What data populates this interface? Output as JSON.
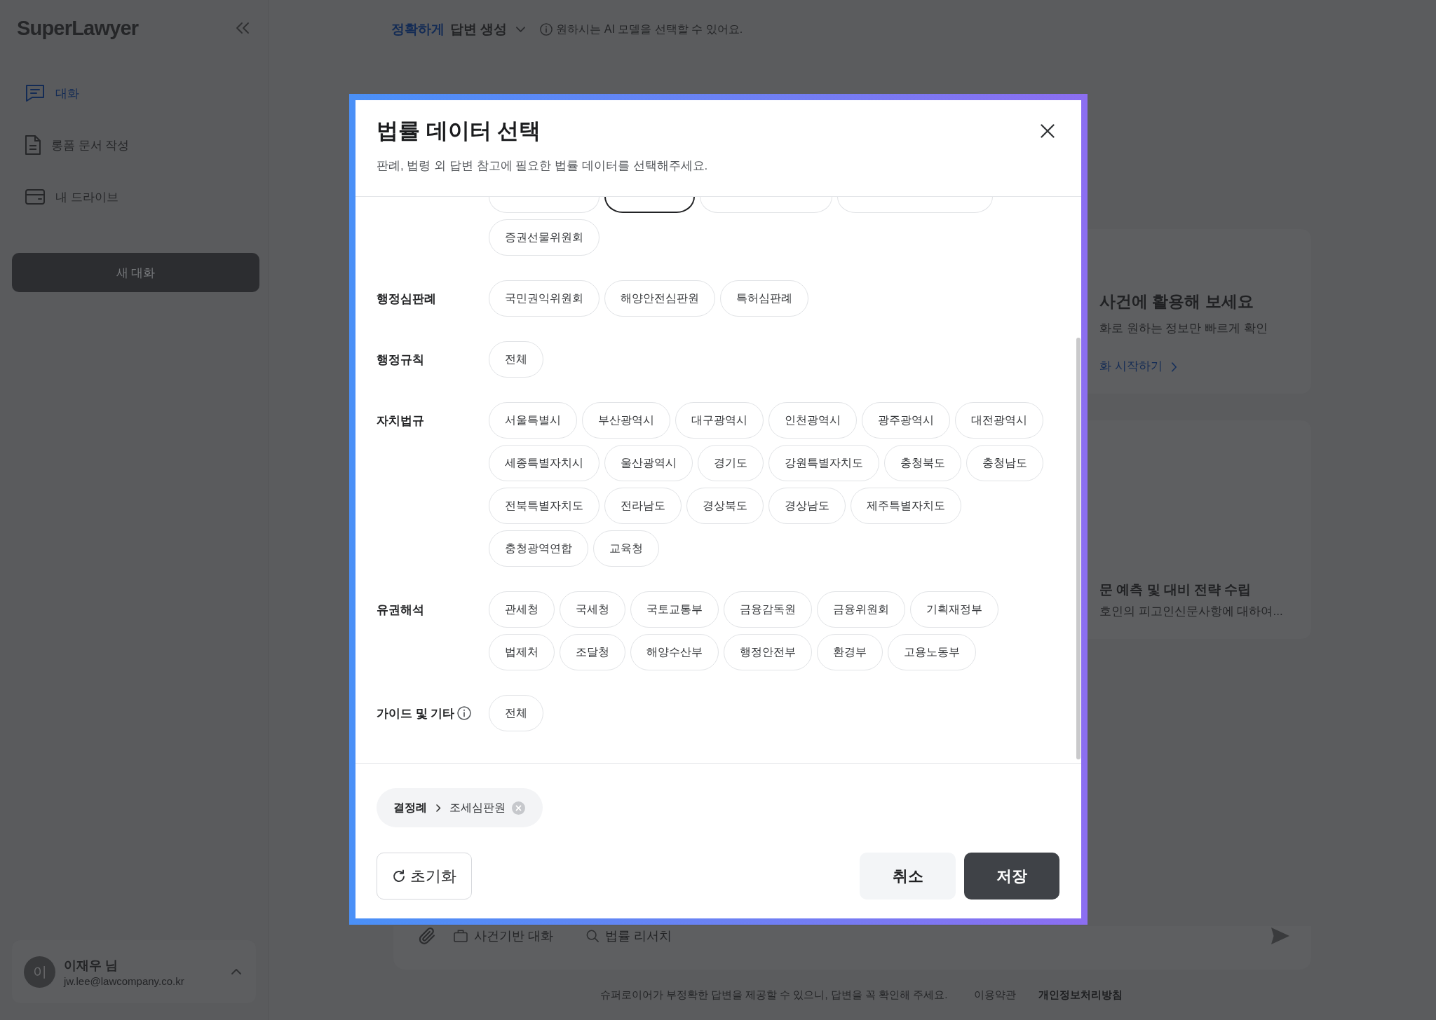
{
  "sidebar": {
    "logo": "SuperLawyer",
    "nav": [
      {
        "label": "대화",
        "kind": "chat",
        "selected": true
      },
      {
        "label": "롱폼 문서 작성",
        "kind": "document",
        "selected": false
      },
      {
        "label": "내 드라이브",
        "kind": "drive",
        "selected": false
      }
    ],
    "new_chat_button": "새 대화",
    "user": {
      "avatar": "이",
      "name": "이재우 님",
      "email": "jw.lee@lawcompany.co.kr"
    }
  },
  "header": {
    "mode": "정확하게",
    "label": "답변 생성",
    "hint": "원하시는 AI 모델을 선택할 수 있어요."
  },
  "cards": [
    {
      "kind": "banner",
      "title": "사건에 활용해 보세요",
      "text": "화로 원하는 정보만 빠르게 확인",
      "link": "화 시작하기"
    },
    {
      "kind": "recent",
      "title": "문 예측 및 대비 전략 수립",
      "text": "호인의 피고인신문사항에 대하여..."
    }
  ],
  "composer": {
    "tools": [
      {
        "kind": "case",
        "label": "사건기반 대화"
      },
      {
        "kind": "research",
        "label": "법률 리서치"
      }
    ]
  },
  "footer": {
    "notice": "슈퍼로이어가 부정확한 답변을 제공할 수 있으니, 답변을 꼭 확인해 주세요.",
    "links": [
      {
        "label": "이용약관",
        "emphasized": false
      },
      {
        "label": "개인정보처리방침",
        "emphasized": true
      }
    ]
  },
  "modal": {
    "title": "법률 데이터 선택",
    "subtitle": "판례, 법령 외 답변 참고에 필요한 법률 데이터를 선택해주세요.",
    "sections": [
      {
        "clipped_chips": [
          {
            "selected": false
          },
          {
            "selected": true
          },
          {
            "selected": false
          },
          {
            "selected": false
          }
        ],
        "chips": [
          {
            "label": "증권선물위원회",
            "selected": false
          }
        ]
      },
      {
        "label": "행정심판례",
        "info": false,
        "chips": [
          {
            "label": "국민권익위원회",
            "selected": false
          },
          {
            "label": "해양안전심판원",
            "selected": false
          },
          {
            "label": "특허심판례",
            "selected": false
          }
        ]
      },
      {
        "label": "행정규칙",
        "info": false,
        "chips": [
          {
            "label": "전체",
            "selected": false
          }
        ]
      },
      {
        "label": "자치법규",
        "info": false,
        "chips": [
          {
            "label": "서울특별시",
            "selected": false
          },
          {
            "label": "부산광역시",
            "selected": false
          },
          {
            "label": "대구광역시",
            "selected": false
          },
          {
            "label": "인천광역시",
            "selected": false
          },
          {
            "label": "광주광역시",
            "selected": false
          },
          {
            "label": "대전광역시",
            "selected": false
          },
          {
            "label": "세종특별자치시",
            "selected": false
          },
          {
            "label": "울산광역시",
            "selected": false
          },
          {
            "label": "경기도",
            "selected": false
          },
          {
            "label": "강원특별자치도",
            "selected": false
          },
          {
            "label": "충청북도",
            "selected": false
          },
          {
            "label": "충청남도",
            "selected": false
          },
          {
            "label": "전북특별자치도",
            "selected": false
          },
          {
            "label": "전라남도",
            "selected": false
          },
          {
            "label": "경상북도",
            "selected": false
          },
          {
            "label": "경상남도",
            "selected": false
          },
          {
            "label": "제주특별자치도",
            "selected": false
          },
          {
            "label": "충청광역연합",
            "selected": false
          },
          {
            "label": "교육청",
            "selected": false
          }
        ]
      },
      {
        "label": "유권해석",
        "info": false,
        "chips": [
          {
            "label": "관세청",
            "selected": false
          },
          {
            "label": "국세청",
            "selected": false
          },
          {
            "label": "국토교통부",
            "selected": false
          },
          {
            "label": "금융감독원",
            "selected": false
          },
          {
            "label": "금융위원회",
            "selected": false
          },
          {
            "label": "기획재정부",
            "selected": false
          },
          {
            "label": "법제처",
            "selected": false
          },
          {
            "label": "조달청",
            "selected": false
          },
          {
            "label": "해양수산부",
            "selected": false
          },
          {
            "label": "행정안전부",
            "selected": false
          },
          {
            "label": "환경부",
            "selected": false
          },
          {
            "label": "고용노동부",
            "selected": false
          }
        ]
      },
      {
        "label": "가이드 및 기타",
        "info": true,
        "chips": [
          {
            "label": "전체",
            "selected": false
          }
        ]
      }
    ],
    "selection": [
      {
        "group": "결정례",
        "item": "조세심판원"
      }
    ],
    "reset_button": "초기화",
    "cancel_button": "취소",
    "save_button": "저장"
  }
}
